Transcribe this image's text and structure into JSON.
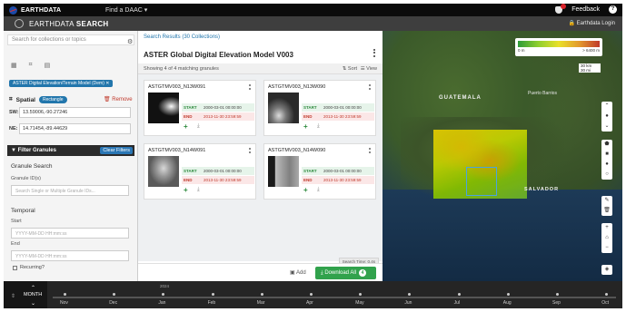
{
  "topbar": {
    "brand": "EARTHDATA",
    "find_daac": "Find a DAAC ▾",
    "feedback": "Feedback",
    "help": "?"
  },
  "app_header": {
    "title_prefix": "EARTHDATA",
    "title_bold": "SEARCH",
    "login": "Earthdata Login"
  },
  "left_panel": {
    "search_placeholder": "Search for collections or topics",
    "collection_chip": "ASTER Digital Elevation/Terrain Model (Dem) ✕",
    "spatial_label": "Spatial",
    "spatial_type": "Rectangle",
    "remove": "Remove",
    "sw_label": "SW:",
    "sw_value": "13.59006,-90.27246",
    "ne_label": "NE:",
    "ne_value": "14.71454,-89.44629",
    "filter_header": "Filter Granules",
    "clear_filters": "Clear Filters",
    "granule_search": "Granule Search",
    "granule_ids_label": "Granule ID(s)",
    "granule_ids_placeholder": "Search Single or Multiple Granule IDs...",
    "temporal": "Temporal",
    "start_label": "Start",
    "start_placeholder": "YYYY-MM-DD HH:mm:ss",
    "end_label": "End",
    "end_placeholder": "YYYY-MM-DD HH:mm:ss",
    "recurring": "Recurring?"
  },
  "results": {
    "breadcrumb": "Search Results (30 Collections)",
    "title": "ASTER Global Digital Elevation Model V003",
    "count": "Showing 4 of 4 matching granules",
    "sort": "Sort",
    "view": "View",
    "granules": [
      {
        "id": "ASTGTMV003_N13W091",
        "start_label": "START",
        "start": "2000-03-01 00:00:00",
        "end_label": "END",
        "end": "2013-11-30 23:59:59"
      },
      {
        "id": "ASTGTMV003_N13W090",
        "start_label": "START",
        "start": "2000-03-01 00:00:00",
        "end_label": "END",
        "end": "2013-11-30 23:59:59"
      },
      {
        "id": "ASTGTMV003_N14W091",
        "start_label": "START",
        "start": "2000-03-01 00:00:00",
        "end_label": "END",
        "end": "2013-11-30 23:59:59"
      },
      {
        "id": "ASTGTMV003_N14W090",
        "start_label": "START",
        "start": "2000-03-01 00:00:00",
        "end_label": "END",
        "end": "2013-11-30 23:59:59"
      }
    ],
    "search_time": "Search Time: 0.4s",
    "add": "Add",
    "download_all": "Download All",
    "download_count": "4"
  },
  "map": {
    "legend_min": "0 m",
    "legend_max": "> 6400 m",
    "scale_km": "30 km",
    "scale_mi": "30 mi",
    "label_guatemala": "GUATEMALA",
    "label_puerto": "Puerto Barrios",
    "label_salvador": "SALVADOR"
  },
  "timeline": {
    "unit": "MONTH",
    "year": "2024",
    "months": [
      "Nov",
      "Dec",
      "Jan",
      "Feb",
      "Mar",
      "Apr",
      "May",
      "Jun",
      "Jul",
      "Aug",
      "Sep",
      "Oct"
    ]
  }
}
